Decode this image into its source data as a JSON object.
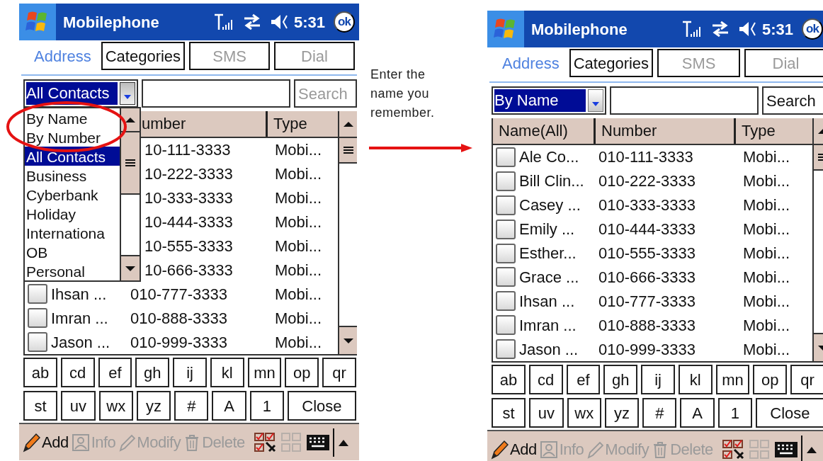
{
  "screens": [
    {
      "title": "Mobilephone",
      "time": "5:31",
      "ok": "ok",
      "tabs": [
        {
          "label": "Address",
          "selected": true,
          "disabled": false
        },
        {
          "label": "Categories",
          "selected": false,
          "disabled": false
        },
        {
          "label": "SMS",
          "selected": false,
          "disabled": true
        },
        {
          "label": "Dial",
          "selected": false,
          "disabled": true
        }
      ],
      "filter": {
        "value": "All Contacts",
        "expanded": true,
        "options": [
          {
            "label": "By Name",
            "selected": false
          },
          {
            "label": "By Number",
            "selected": false
          },
          {
            "label": "All Contacts",
            "selected": true
          },
          {
            "label": "Business",
            "selected": false
          },
          {
            "label": "Cyberbank",
            "selected": false
          },
          {
            "label": "Holiday",
            "selected": false
          },
          {
            "label": "Internationa",
            "selected": false
          },
          {
            "label": "OB",
            "selected": false
          },
          {
            "label": "Personal",
            "selected": false
          }
        ]
      },
      "search_button": {
        "label": "Search",
        "disabled": true
      },
      "columns": [
        {},
        {
          "label": "umber"
        },
        {
          "label": "Type"
        }
      ],
      "rows": [
        {
          "number": "10-111-3333",
          "type": "Mobi..."
        },
        {
          "number": "10-222-3333",
          "type": "Mobi..."
        },
        {
          "number": "10-333-3333",
          "type": "Mobi..."
        },
        {
          "number": "10-444-3333",
          "type": "Mobi..."
        },
        {
          "number": "10-555-3333",
          "type": "Mobi..."
        },
        {
          "number": "10-666-3333",
          "type": "Mobi..."
        },
        {
          "name": "Ihsan ...",
          "checked": false,
          "number": "010-777-3333",
          "type": "Mobi..."
        },
        {
          "name": "Imran ...",
          "checked": false,
          "number": "010-888-3333",
          "type": "Mobi..."
        },
        {
          "name": "Jason ...",
          "checked": false,
          "number": "010-999-3333",
          "type": "Mobi..."
        }
      ],
      "keys": [
        [
          "ab",
          "cd",
          "ef",
          "gh",
          "ij",
          "kl",
          "mn",
          "op",
          "qr"
        ],
        [
          "st",
          "uv",
          "wx",
          "yz",
          "#",
          "A",
          "1",
          "Close"
        ]
      ],
      "toolbar": [
        {
          "kind": "add",
          "label": "Add",
          "disabled": false
        },
        {
          "kind": "info",
          "label": "Info",
          "disabled": true
        },
        {
          "kind": "modify",
          "label": "Modify",
          "disabled": true
        },
        {
          "kind": "delete",
          "label": "Delete",
          "disabled": true
        },
        {
          "kind": "checklist",
          "disabled": false
        },
        {
          "kind": "grid",
          "disabled": true
        },
        {
          "kind": "keyboard",
          "disabled": false
        },
        {
          "kind": "caret",
          "disabled": false
        }
      ]
    },
    {
      "title": "Mobilephone",
      "time": "5:31",
      "ok": "ok",
      "tabs": [
        {
          "label": "Address",
          "selected": true,
          "disabled": false
        },
        {
          "label": "Categories",
          "selected": false,
          "disabled": false
        },
        {
          "label": "SMS",
          "selected": false,
          "disabled": true
        },
        {
          "label": "Dial",
          "selected": false,
          "disabled": true
        }
      ],
      "filter": {
        "value": "By Name",
        "expanded": false
      },
      "search_button": {
        "label": "Search",
        "disabled": false
      },
      "columns": [
        {
          "label": "Name(All)"
        },
        {
          "label": "Number"
        },
        {
          "label": "Type"
        }
      ],
      "rows": [
        {
          "name": "Ale Co...",
          "checked": false,
          "number": "010-111-3333",
          "type": "Mobi..."
        },
        {
          "name": "Bill Clin...",
          "checked": false,
          "number": "010-222-3333",
          "type": "Mobi..."
        },
        {
          "name": "Casey ...",
          "checked": false,
          "number": "010-333-3333",
          "type": "Mobi..."
        },
        {
          "name": "Emily ...",
          "checked": false,
          "number": "010-444-3333",
          "type": "Mobi..."
        },
        {
          "name": "Esther...",
          "checked": false,
          "number": "010-555-3333",
          "type": "Mobi..."
        },
        {
          "name": "Grace ...",
          "checked": false,
          "number": "010-666-3333",
          "type": "Mobi..."
        },
        {
          "name": "Ihsan ...",
          "checked": false,
          "number": "010-777-3333",
          "type": "Mobi..."
        },
        {
          "name": "Imran ...",
          "checked": false,
          "number": "010-888-3333",
          "type": "Mobi..."
        },
        {
          "name": "Jason ...",
          "checked": false,
          "number": "010-999-3333",
          "type": "Mobi..."
        }
      ],
      "keys": [
        [
          "ab",
          "cd",
          "ef",
          "gh",
          "ij",
          "kl",
          "mn",
          "op",
          "qr"
        ],
        [
          "st",
          "uv",
          "wx",
          "yz",
          "#",
          "A",
          "1",
          "Close"
        ]
      ],
      "toolbar": [
        {
          "kind": "add",
          "label": "Add",
          "disabled": false
        },
        {
          "kind": "info",
          "label": "Info",
          "disabled": true
        },
        {
          "kind": "modify",
          "label": "Modify",
          "disabled": true
        },
        {
          "kind": "delete",
          "label": "Delete",
          "disabled": true
        },
        {
          "kind": "checklist",
          "disabled": false
        },
        {
          "kind": "grid",
          "disabled": true
        },
        {
          "kind": "keyboard",
          "disabled": false
        },
        {
          "kind": "caret",
          "disabled": false
        }
      ]
    }
  ],
  "annotation": {
    "text": "Enter the name you remember."
  }
}
